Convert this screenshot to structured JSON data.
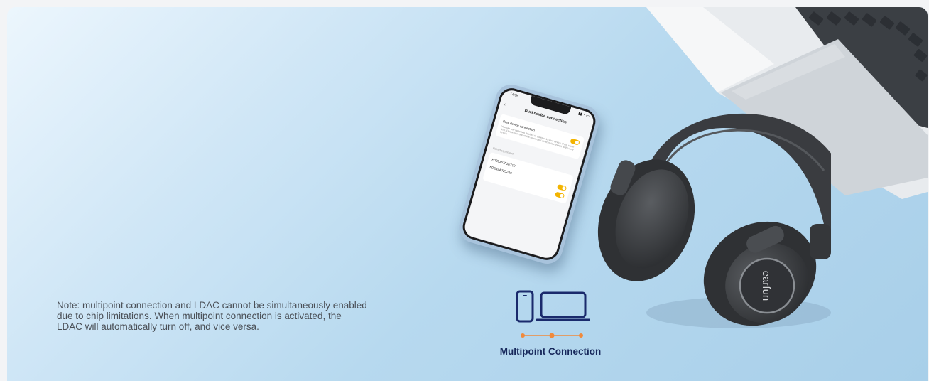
{
  "note": {
    "text": "Note: multipoint connection and LDAC cannot be simultaneously enabled due to chip limitations. When multipoint connection is activated, the LDAC will automatically turn off, and vice versa."
  },
  "phone": {
    "status_time": "14:56",
    "screen_title": "Dual device connection",
    "setting_label": "Dual device connection",
    "setting_desc": "You can use up to two devices to connect to your device at the same time. Disconnect one of the connected devices to connect to the new device.",
    "section_label": "Paired equipment",
    "devices": [
      {
        "name": "F0B9167F1E719"
      },
      {
        "name": "6D8A9A7252A0"
      }
    ]
  },
  "headphones": {
    "brand": "earfun"
  },
  "badge": {
    "label": "Multipoint Connection",
    "stroke_color": "#1a2a6c",
    "dot_color": "#f08a3c"
  },
  "colors": {
    "toggle_on": "#f3b400",
    "headphone_body": "#3b3d40"
  }
}
